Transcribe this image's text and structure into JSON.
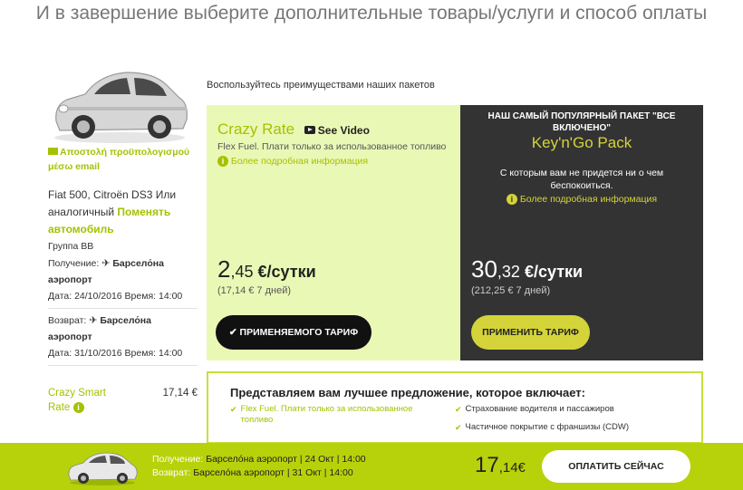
{
  "page": {
    "title": "И в завершение выберите дополнительные товары/услуги и способ оплаты"
  },
  "sidebar": {
    "email_link": "Αποστολή προϋπολογισμού μέσω email",
    "car_name": "Fiat 500, Citroën DS3",
    "car_or": "Или аналогичный",
    "change_car": "Поменять автомобиль",
    "group": "Группа BB",
    "pickup_label": "Получение:",
    "pickup_location": "Барсело́на аэропорт",
    "pickup_date": "Дата: 24/10/2016 Время: 14:00",
    "return_label": "Возврат:",
    "return_location": "Барсело́на аэропорт",
    "return_date": "Дата: 31/10/2016 Время: 14:00",
    "rate_name": "Crazy Smart Rate",
    "rate_price": "17,14 €"
  },
  "packages": {
    "intro": "Воспользуйтесь преимуществами наших пакетов",
    "crazy": {
      "name": "Crazy Rate",
      "video": "See Video",
      "desc": "Flex Fuel. Плати только за использованное топливо",
      "more": "Более подробная информация",
      "price_int": "2",
      "price_cents": ",45",
      "price_unit": " €/сутки",
      "week": "(17,14 € 7 дней)",
      "button": "ПРИМЕНЯЕМОГО ТАРИФ"
    },
    "keygo": {
      "top": "НАШ САМЫЙ ПОПУЛЯРНЫЙ ПАКЕТ \"ВСЕ ВКЛЮЧЕНО\"",
      "name": "Key'n'Go Pack",
      "desc": "С которым вам не придется ни о чем беспокоиться.",
      "more": "Более подробная информация",
      "price_int": "30",
      "price_cents": ",32",
      "price_unit": " €/сутки",
      "week": "(212,25 € 7 дней)",
      "button": "ПРИМЕНИТЬ ТАРИФ"
    }
  },
  "offer": {
    "title": "Представляем вам лучшее предложение, которое включает:",
    "left_items": [
      "Flex Fuel. Плати только за использованное топливо"
    ],
    "right_items": [
      "Страхование водителя и пассажиров",
      "Частичное покрытие с франшизы (CDW)"
    ]
  },
  "bottom": {
    "pickup_label": "Получение:",
    "pickup_value": "Барсело́на аэропорт | 24 Окт | 14:00",
    "return_label": "Возврат:",
    "return_value": "Барсело́на аэропорт | 31 Окт | 14:00",
    "price_int": "17",
    "price_cents": ",14€",
    "pay_button": "ОПЛАТИТЬ СЕЙЧАС"
  },
  "colors": {
    "accent": "#a6c100",
    "bar": "#b7d20a",
    "dark": "#333333",
    "light_green": "#eaf8b6"
  }
}
